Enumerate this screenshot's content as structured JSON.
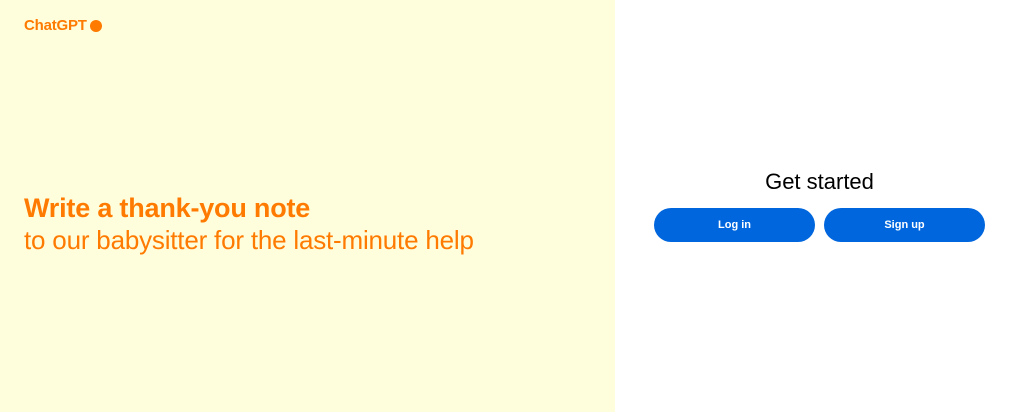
{
  "brand": {
    "name": "ChatGPT",
    "color": "#FF7A00"
  },
  "hero": {
    "bold_line": "Write a thank-you note",
    "regular_text": "to our babysitter for the last-minute help",
    "background": "#FFFEDC",
    "text_color": "#FF7A00"
  },
  "auth": {
    "title": "Get started",
    "login_label": "Log in",
    "signup_label": "Sign up",
    "button_color": "#0066DE"
  }
}
